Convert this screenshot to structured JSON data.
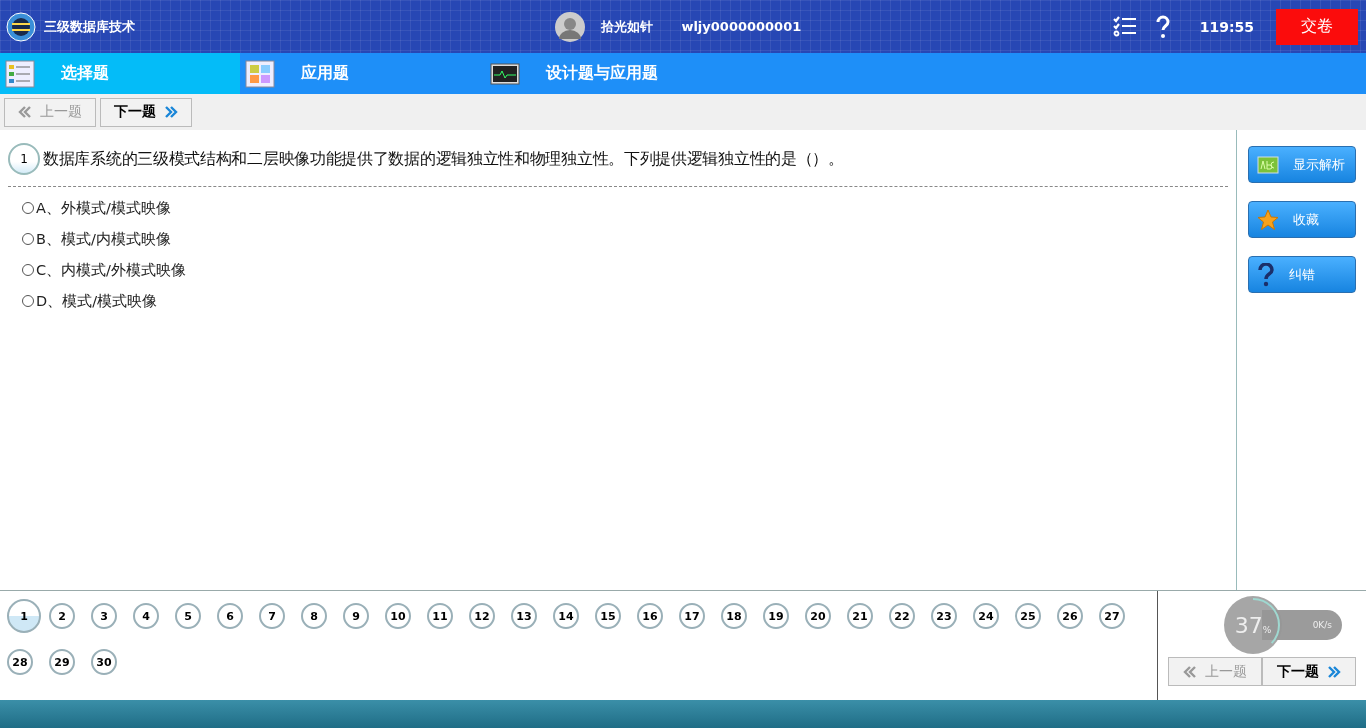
{
  "header": {
    "title": "三级数据库技术",
    "user_name": "拾光如针",
    "user_id": "wljy0000000001",
    "timer": "119:55",
    "submit": "交卷"
  },
  "tabs": [
    {
      "label": "选择题",
      "selected": true
    },
    {
      "label": "应用题",
      "selected": false
    },
    {
      "label": "设计题与应用题",
      "selected": false
    }
  ],
  "top_nav": {
    "prev": {
      "label": "上一题",
      "disabled": true
    },
    "next": {
      "label": "下一题",
      "disabled": false
    }
  },
  "question": {
    "number": "1",
    "text": "数据库系统的三级模式结构和二层映像功能提供了数据的逻辑独立性和物理独立性。下列提供逻辑独立性的是（）。",
    "options": [
      {
        "label": "A、外模式/模式映像",
        "selected": false
      },
      {
        "label": "B、模式/内模式映像",
        "selected": false
      },
      {
        "label": "C、内模式/外模式映像",
        "selected": false
      },
      {
        "label": "D、模式/模式映像",
        "selected": false
      }
    ]
  },
  "side_buttons": [
    {
      "label": "显示解析"
    },
    {
      "label": "收藏"
    },
    {
      "label": "纠错"
    }
  ],
  "question_numbers": [
    {
      "label": "1",
      "selected": true
    },
    {
      "label": "2",
      "selected": false
    },
    {
      "label": "3",
      "selected": false
    },
    {
      "label": "4",
      "selected": false
    },
    {
      "label": "5",
      "selected": false
    },
    {
      "label": "6",
      "selected": false
    },
    {
      "label": "7",
      "selected": false
    },
    {
      "label": "8",
      "selected": false
    },
    {
      "label": "9",
      "selected": false
    },
    {
      "label": "10",
      "selected": false
    },
    {
      "label": "11",
      "selected": false
    },
    {
      "label": "12",
      "selected": false
    },
    {
      "label": "13",
      "selected": false
    },
    {
      "label": "14",
      "selected": false
    },
    {
      "label": "15",
      "selected": false
    },
    {
      "label": "16",
      "selected": false
    },
    {
      "label": "17",
      "selected": false
    },
    {
      "label": "18",
      "selected": false
    },
    {
      "label": "19",
      "selected": false
    },
    {
      "label": "20",
      "selected": false
    },
    {
      "label": "21",
      "selected": false
    },
    {
      "label": "22",
      "selected": false
    },
    {
      "label": "23",
      "selected": false
    },
    {
      "label": "24",
      "selected": false
    },
    {
      "label": "25",
      "selected": false
    },
    {
      "label": "26",
      "selected": false
    },
    {
      "label": "27",
      "selected": false
    },
    {
      "label": "28",
      "selected": false
    },
    {
      "label": "29",
      "selected": false
    },
    {
      "label": "30",
      "selected": false
    }
  ],
  "bottom_nav": {
    "prev": {
      "label": "上一题",
      "disabled": true
    },
    "next": {
      "label": "下一题",
      "disabled": false
    }
  },
  "speed_widget": {
    "percent": "37",
    "percent_sign": "%",
    "speed": "0K/s"
  }
}
